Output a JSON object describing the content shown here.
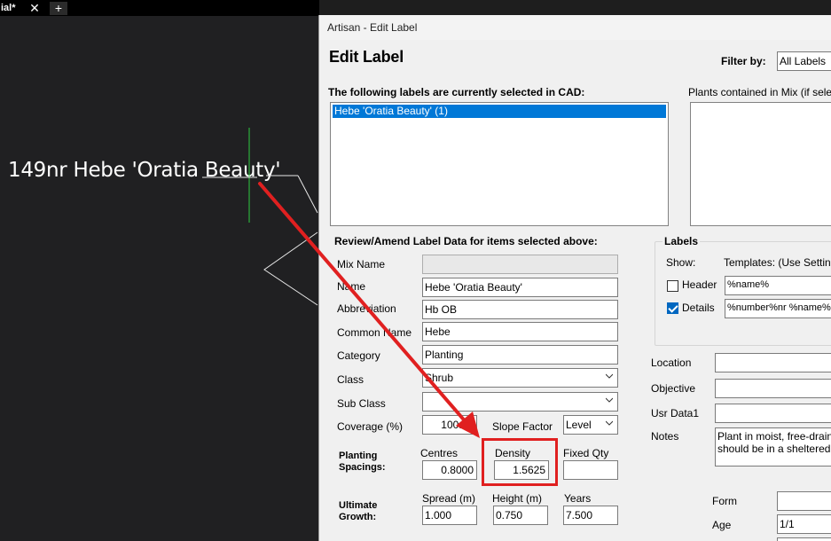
{
  "cad": {
    "tab_label": "ial*",
    "label_text": "149nr Hebe 'Oratia Beauty'"
  },
  "dialog": {
    "title": "Artisan - Edit Label",
    "heading": "Edit Label",
    "filter_label": "Filter by:",
    "filter_value": "All Labels",
    "selected_labels_caption": "The following labels are currently selected in CAD:",
    "selected_items": [
      "Hebe 'Oratia Beauty' (1)"
    ],
    "plants_caption": "Plants contained in Mix (if selecte",
    "review_caption": "Review/Amend Label Data for items selected above:",
    "fields": {
      "mix_name": {
        "label": "Mix Name",
        "value": ""
      },
      "name": {
        "label": "Name",
        "value": "Hebe 'Oratia Beauty'"
      },
      "abbreviation": {
        "label": "Abbreviation",
        "value": "Hb OB"
      },
      "common_name": {
        "label": "Common Name",
        "value": "Hebe"
      },
      "category": {
        "label": "Category",
        "value": "Planting"
      },
      "class": {
        "label": "Class",
        "value": "Shrub"
      },
      "sub_class": {
        "label": "Sub Class",
        "value": ""
      },
      "coverage": {
        "label": "Coverage (%)",
        "value": "100.00"
      },
      "slope_factor": {
        "label": "Slope Factor",
        "value": "Level"
      }
    },
    "planting": {
      "label_line1": "Planting",
      "label_line2": "Spacings:",
      "centres_label": "Centres",
      "centres_value": "0.8000",
      "density_label": "Density",
      "density_value": "1.5625",
      "fixed_qty_label": "Fixed Qty",
      "fixed_qty_value": ""
    },
    "growth": {
      "label_line1": "Ultimate",
      "label_line2": "Growth:",
      "spread_label": "Spread (m)",
      "spread_value": "1.000",
      "height_label": "Height (m)",
      "height_value": "0.750",
      "years_label": "Years",
      "years_value": "7.500"
    },
    "labels_group": {
      "title": "Labels",
      "show_label": "Show:",
      "templates_label": "Templates:  (Use Setting",
      "header_label": "Header",
      "header_checked": false,
      "header_template": "%name%",
      "details_label": "Details",
      "details_checked": true,
      "details_template": "%number%nr %name%"
    },
    "right_fields": {
      "location_label": "Location",
      "objective_label": "Objective",
      "usr_data1_label": "Usr Data1",
      "notes_label": "Notes",
      "notes_line1": "Plant in moist, free-drain",
      "notes_line2": "should be in a sheltered",
      "form_label": "Form",
      "age_label": "Age",
      "age_value": "1/1"
    }
  },
  "colors": {
    "highlight": "#e02020",
    "arrow": "#e02020",
    "selection": "#0078d7"
  }
}
